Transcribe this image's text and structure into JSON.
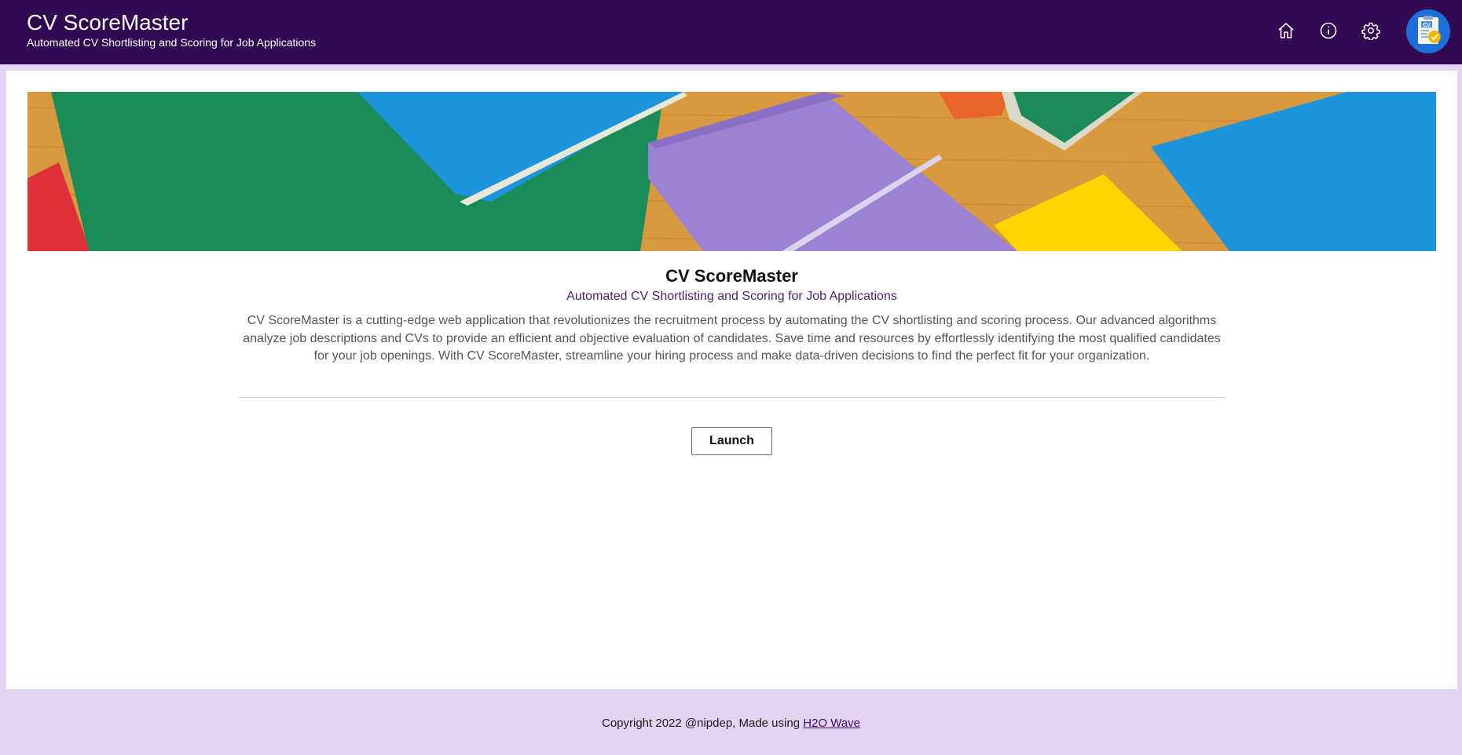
{
  "header": {
    "title": "CV ScoreMaster",
    "subtitle": "Automated CV Shortlisting and Scoring for Job Applications",
    "icons": [
      "home-icon",
      "info-icon",
      "settings-icon"
    ],
    "logo_text": "CV",
    "bg_color": "#320953"
  },
  "main": {
    "title": "CV ScoreMaster",
    "subtitle": "Automated CV Shortlisting and Scoring for Job Applications",
    "description": "CV ScoreMaster is a cutting-edge web application that revolutionizes the recruitment process by automating the CV shortlisting and scoring process. Our advanced algorithms analyze job descriptions and CVs to provide an efficient and objective evaluation of candidates. Save time and resources by effortlessly identifying the most qualified candidates for your job openings. With CV ScoreMaster, streamline your hiring process and make data-driven decisions to find the perfect fit for your organization.",
    "launch_label": "Launch"
  },
  "footer": {
    "text": "Copyright 2022 @nipdep, Made using ",
    "link_label": "H2O Wave"
  },
  "colors": {
    "accent": "#4a1f7a",
    "page_bg": "#e4d4f3"
  }
}
